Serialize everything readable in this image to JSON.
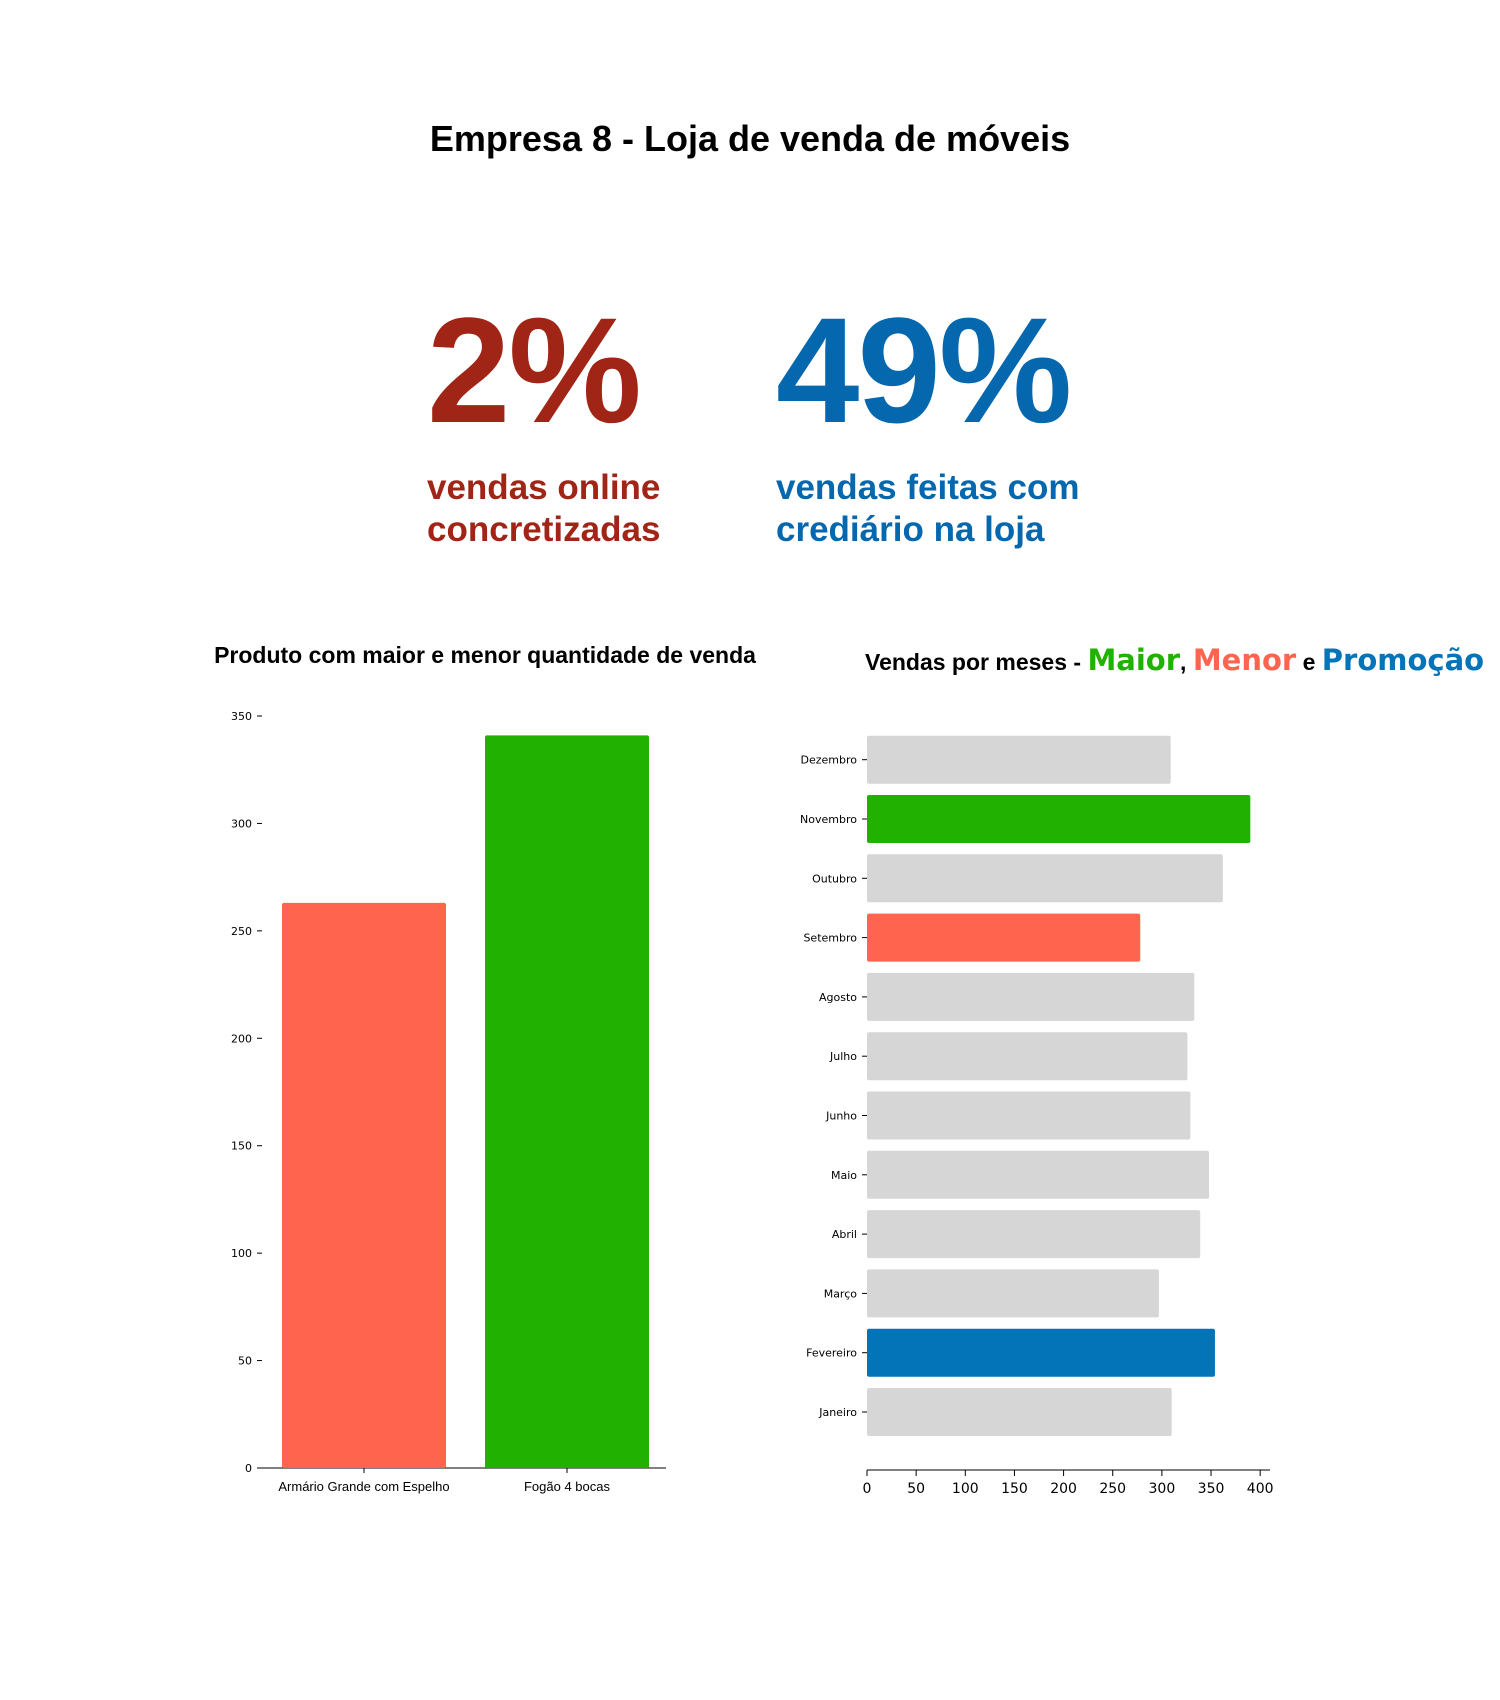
{
  "page": {
    "title": "Empresa 8 - Loja de venda de móveis"
  },
  "kpis": [
    {
      "value": "2%",
      "line1": "vendas online",
      "line2": "concretizadas",
      "color": "#A12516"
    },
    {
      "value": "49%",
      "line1": "vendas feitas com",
      "line2": "crediário na loja",
      "color": "#0567AE"
    }
  ],
  "colors": {
    "maior": "#21B100",
    "menor": "#FF644E",
    "promocao": "#0474B9",
    "neutral": "#D6D6D6"
  },
  "chart_data": [
    {
      "type": "bar",
      "title": "Produto com maior e menor quantidade de venda",
      "categories": [
        "Armário Grande com Espelho",
        "Fogão 4 bocas"
      ],
      "values": [
        263,
        341
      ],
      "bar_colors": [
        "#FF644E",
        "#21B100"
      ],
      "ylim": [
        0,
        350
      ],
      "yticks": [
        "0",
        "50",
        "100",
        "150",
        "200",
        "250",
        "300",
        "350"
      ],
      "xlabel": "",
      "ylabel": "",
      "grid": false
    },
    {
      "type": "bar",
      "orientation": "horizontal",
      "title_prefix": "Vendas por meses - ",
      "title_parts": {
        "maior": "Maior",
        "sep1": ",",
        "menor": "Menor",
        "sep2": " e ",
        "promocao": "Promoção"
      },
      "categories": [
        "Janeiro",
        "Fevereiro",
        "Março",
        "Abril",
        "Maio",
        "Junho",
        "Julho",
        "Agosto",
        "Setembro",
        "Outubro",
        "Novembro",
        "Dezembro"
      ],
      "values": [
        310,
        354,
        297,
        339,
        348,
        329,
        326,
        333,
        278,
        362,
        390,
        309
      ],
      "bar_colors": [
        "#D6D6D6",
        "#0474B9",
        "#D6D6D6",
        "#D6D6D6",
        "#D6D6D6",
        "#D6D6D6",
        "#D6D6D6",
        "#D6D6D6",
        "#FF644E",
        "#D6D6D6",
        "#21B100",
        "#D6D6D6"
      ],
      "xlim": [
        0,
        410
      ],
      "xticks": [
        "0",
        "50",
        "100",
        "150",
        "200",
        "250",
        "300",
        "350",
        "400"
      ],
      "xlabel": "",
      "ylabel": "",
      "grid": false
    }
  ]
}
